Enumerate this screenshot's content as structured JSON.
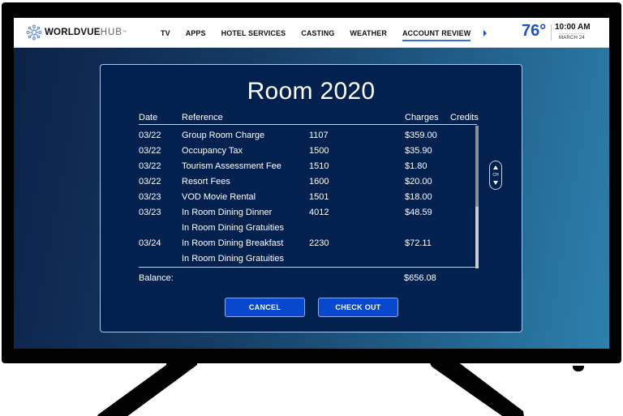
{
  "topbar": {
    "logo_word": "WORLDVUE",
    "logo_hub": "HUB",
    "logo_tm": "™",
    "nav": [
      {
        "label": "TV",
        "active": false
      },
      {
        "label": "APPS",
        "active": false
      },
      {
        "label": "HOTEL SERVICES",
        "active": false
      },
      {
        "label": "CASTING",
        "active": false
      },
      {
        "label": "WEATHER",
        "active": false
      },
      {
        "label": "ACCOUNT REVIEW",
        "active": true
      }
    ],
    "temperature": "76°",
    "time": "10:00 AM",
    "date": "MARCH 24"
  },
  "panel": {
    "title": "Room 2020",
    "columns": {
      "date": "Date",
      "reference": "Reference",
      "charges": "Charges",
      "credits": "Credits"
    },
    "rows": [
      {
        "date": "03/22",
        "reference": "Group Room Charge",
        "code": "1107",
        "charges": "$359.00",
        "credits": ""
      },
      {
        "date": "03/22",
        "reference": "Occupancy Tax",
        "code": "1500",
        "charges": "$35.90",
        "credits": ""
      },
      {
        "date": "03/22",
        "reference": "Tourism Assessment Fee",
        "code": "1510",
        "charges": "$1.80",
        "credits": ""
      },
      {
        "date": "03/22",
        "reference": "Resort Fees",
        "code": "1600",
        "charges": "$20.00",
        "credits": ""
      },
      {
        "date": "03/23",
        "reference": "VOD Movie Rental",
        "code": "1501",
        "charges": "$18.00",
        "credits": ""
      },
      {
        "date": "03/23",
        "reference": "In Room Dining Dinner",
        "code": "4012",
        "charges": "$48.59",
        "credits": ""
      },
      {
        "date": "",
        "reference": "In Room Dining Gratuities",
        "code": "",
        "charges": "",
        "credits": ""
      },
      {
        "date": "03/24",
        "reference": "In Room Dining Breakfast",
        "code": "2230",
        "charges": "$72.11",
        "credits": ""
      },
      {
        "date": "",
        "reference": "In Room Dining Gratuities",
        "code": "",
        "charges": "",
        "credits": ""
      }
    ],
    "balance_label": "Balance:",
    "balance_value": "$656.08",
    "ch_label": "CH",
    "cancel_label": "CANCEL",
    "checkout_label": "CHECK OUT"
  },
  "colors": {
    "accent": "#0748cf",
    "panel_bg": "#03214f",
    "temperature": "#1d4fc8"
  }
}
